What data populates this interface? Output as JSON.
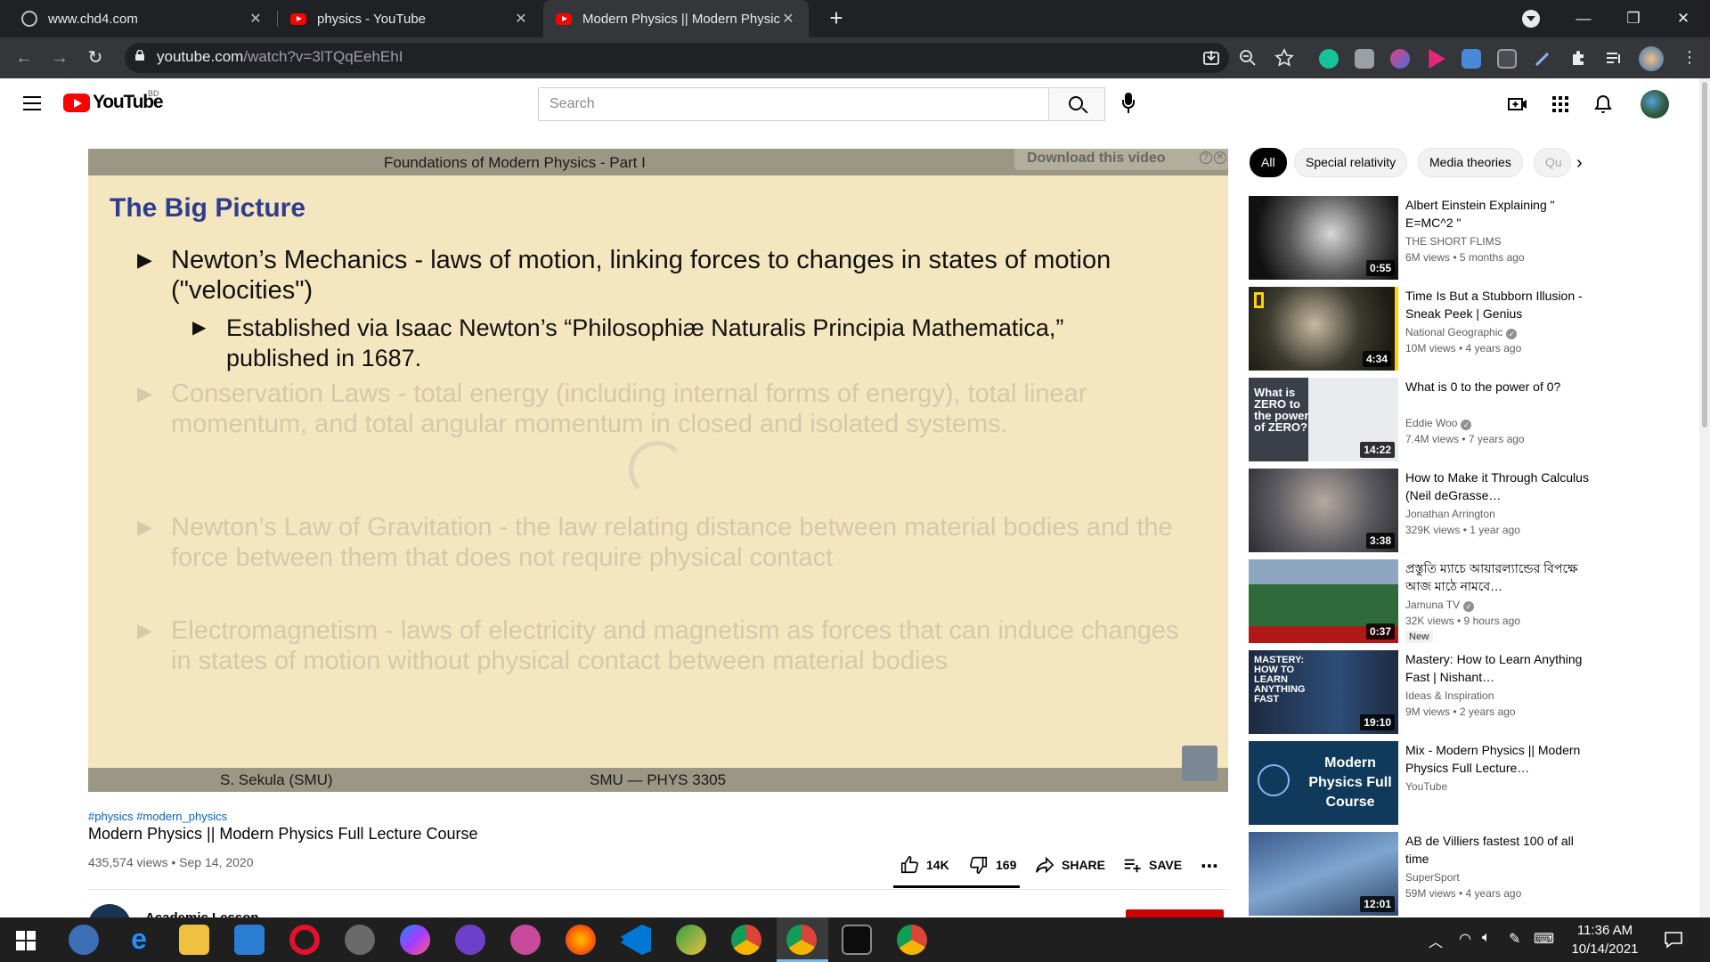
{
  "browser": {
    "tabs": [
      {
        "title": "www.chd4.com",
        "favicon": "globe-icon"
      },
      {
        "title": "physics - YouTube",
        "favicon": "youtube-icon"
      },
      {
        "title": "Modern Physics || Modern Physic",
        "favicon": "youtube-icon",
        "active": true
      }
    ],
    "url_host": "youtube.com",
    "url_path": "/watch?v=3lTQqEehEhI"
  },
  "masthead": {
    "logo_text": "YouTube",
    "country_code": "BD",
    "search_placeholder": "Search"
  },
  "player": {
    "download_label": "Download this video",
    "slide": {
      "header": "Foundations of Modern Physics - Part I",
      "title": "The Big Picture",
      "bullets": [
        {
          "text": "Newton’s Mechanics - laws of motion, linking forces to changes in states of motion (\"velocities\")"
        },
        {
          "text": "Established via Isaac Newton’s “Philosophiæ Naturalis Principia Mathematica,” published in 1687."
        },
        {
          "text": "Conservation Laws - total energy (including internal forms of energy), total linear momentum, and total angular momentum in closed and isolated systems."
        },
        {
          "text": "Newton’s Law of Gravitation - the law relating distance between material bodies and the force between them that does not require physical contact"
        },
        {
          "text": "Electromagnetism - laws of electricity and magnetism as forces that can induce changes in states of motion without physical contact between material bodies"
        }
      ],
      "footer_left": "S. Sekula (SMU)",
      "footer_center": "SMU — PHYS 3305"
    }
  },
  "video": {
    "hashtags": "#physics #modern_physics",
    "title": "Modern Physics || Modern Physics Full Lecture Course",
    "views_date": "435,574 views • Sep 14, 2020",
    "likes": "14K",
    "dislikes": "169",
    "share_label": "SHARE",
    "save_label": "SAVE",
    "owner": "Academic Lesson"
  },
  "chips": [
    "All",
    "Special relativity",
    "Media theories",
    "Qu"
  ],
  "recommendations": [
    {
      "title": "Albert Einstein Explaining \" E=MC^2 \"",
      "channel": "THE SHORT FLIMS",
      "meta": "6M views • 5 months ago",
      "duration": "0:55",
      "verified": false
    },
    {
      "title": "Time Is But a Stubborn Illusion - Sneak Peek | Genius",
      "channel": "National Geographic",
      "meta": "10M views • 4 years ago",
      "duration": "4:34",
      "verified": true
    },
    {
      "title": "What is 0 to the power of 0?",
      "channel": "Eddie Woo",
      "meta": "7.4M views • 7 years ago",
      "duration": "14:22",
      "verified": true,
      "thumb_text": "What is ZERO to the power of ZERO?"
    },
    {
      "title": "How to Make it Through Calculus (Neil deGrasse…",
      "channel": "Jonathan Arrington",
      "meta": "329K views • 1 year ago",
      "duration": "3:38",
      "verified": false
    },
    {
      "title": "প্রস্তুতি ম্যাচে আয়ারল্যান্ডের বিপক্ষে আজ মাঠে নামবে…",
      "channel": "Jamuna TV",
      "meta": "32K views • 9 hours ago",
      "duration": "0:37",
      "verified": true,
      "badge": "New"
    },
    {
      "title": "Mastery: How to Learn Anything Fast | Nishant…",
      "channel": "Ideas & Inspiration",
      "meta": "9M views • 2 years ago",
      "duration": "19:10",
      "verified": false,
      "thumb_text": "MASTERY: HOW TO LEARN ANYTHING FAST"
    },
    {
      "title": "Mix - Modern Physics || Modern Physics Full Lecture…",
      "channel": "YouTube",
      "meta": "",
      "duration": "",
      "verified": false,
      "thumb_text": "Modern Physics Full Course"
    },
    {
      "title": "AB de Villiers fastest 100 of all time",
      "channel": "SuperSport",
      "meta": "59M views • 4 years ago",
      "duration": "12:01",
      "verified": false
    }
  ],
  "taskbar": {
    "time": "11:36 AM",
    "date": "10/14/2021"
  }
}
